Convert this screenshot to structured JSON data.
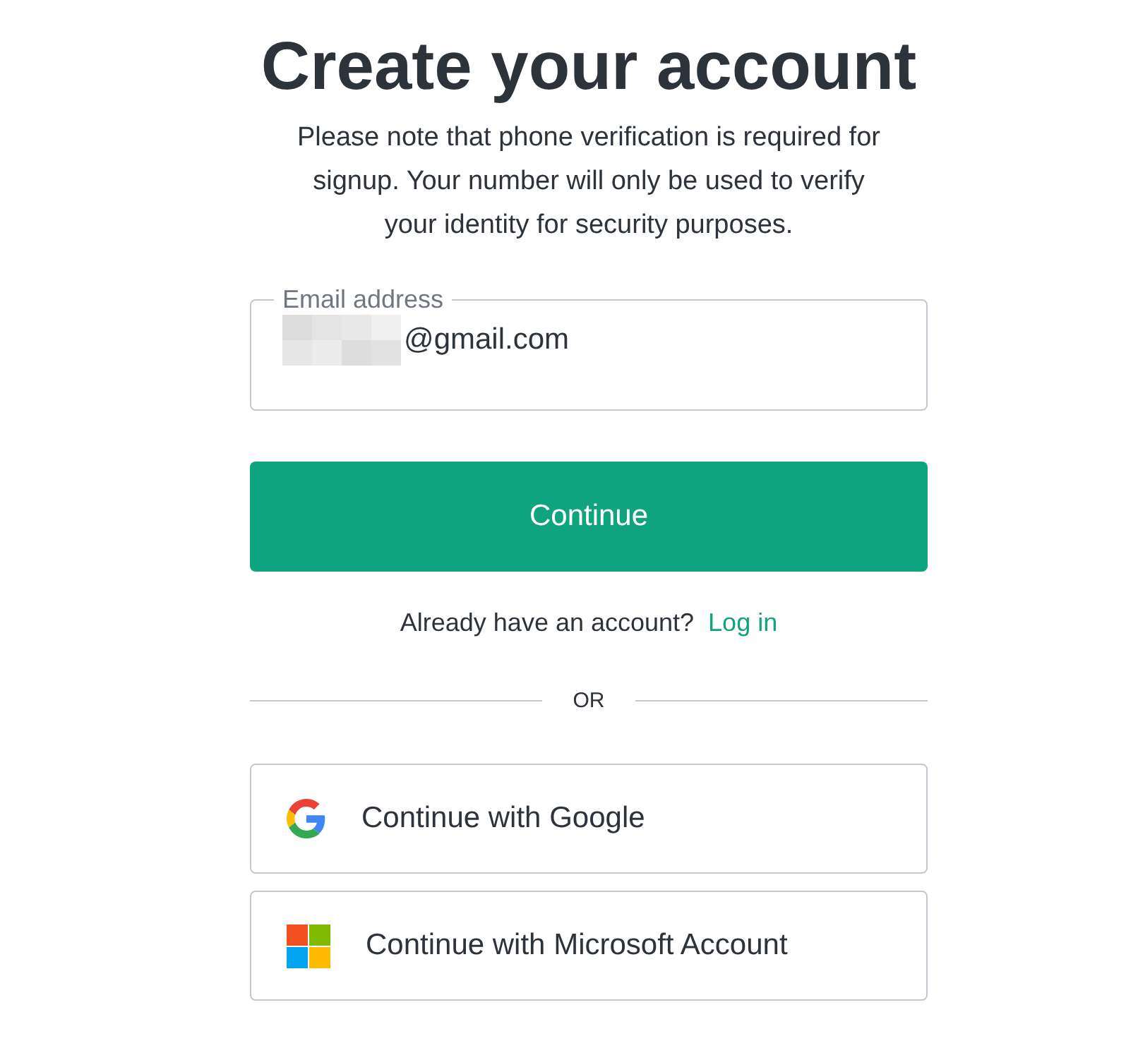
{
  "title": "Create your account",
  "note": "Please note that phone verification is required for signup. Your number will only be used to verify your identity for security purposes.",
  "email_field": {
    "label": "Email address",
    "value": "@gmail.com",
    "redacted_prefix": true
  },
  "continue_button": "Continue",
  "login_prompt": {
    "text": "Already have an account?",
    "link": "Log in"
  },
  "divider": "OR",
  "social_buttons": [
    {
      "kind": "google",
      "label": "Continue with Google"
    },
    {
      "kind": "microsoft",
      "label": "Continue with Microsoft Account"
    }
  ]
}
